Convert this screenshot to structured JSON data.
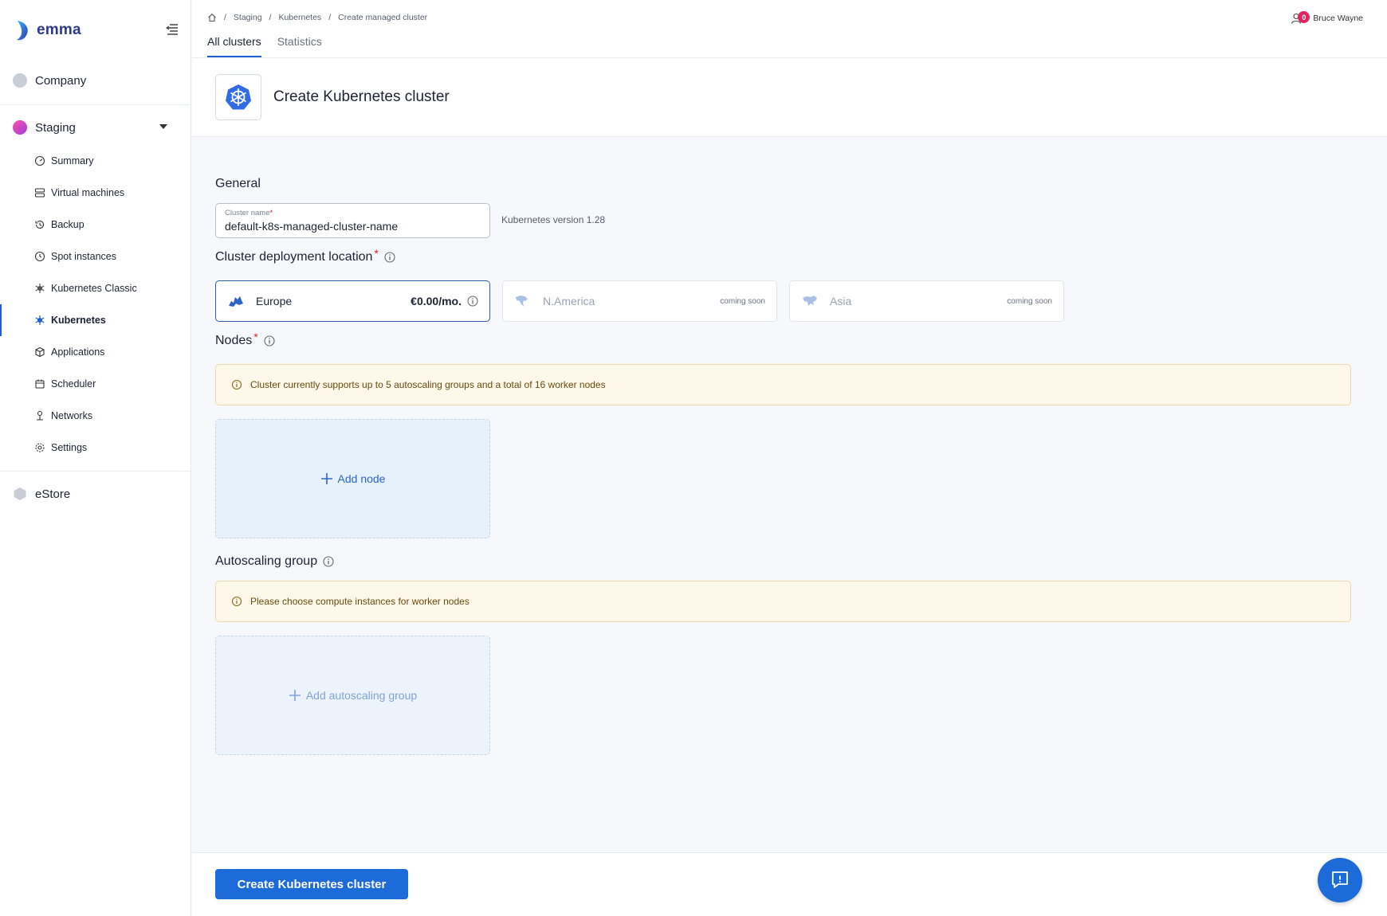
{
  "brand": {
    "name": "emma",
    "color": "#1d5fd6"
  },
  "sidebar": {
    "orgs": [
      {
        "label": "Company"
      },
      {
        "label": "Staging"
      },
      {
        "label": "eStore"
      }
    ],
    "items": [
      {
        "label": "Summary",
        "icon": "gauge-icon"
      },
      {
        "label": "Virtual machines",
        "icon": "server-icon"
      },
      {
        "label": "Backup",
        "icon": "history-icon"
      },
      {
        "label": "Spot instances",
        "icon": "clock-icon"
      },
      {
        "label": "Kubernetes Classic",
        "icon": "kubernetes-icon"
      },
      {
        "label": "Kubernetes",
        "icon": "kubernetes-icon",
        "active": true
      },
      {
        "label": "Applications",
        "icon": "cube-icon"
      },
      {
        "label": "Scheduler",
        "icon": "calendar-icon"
      },
      {
        "label": "Networks",
        "icon": "network-icon"
      },
      {
        "label": "Settings",
        "icon": "gear-icon"
      }
    ]
  },
  "header": {
    "breadcrumbs": [
      "Staging",
      "Kubernetes",
      "Create managed cluster"
    ],
    "tabs": [
      {
        "label": "All clusters",
        "active": true
      },
      {
        "label": "Statistics"
      }
    ],
    "user": {
      "name": "Bruce Wayne",
      "notifications": "0"
    }
  },
  "page": {
    "title": "Create Kubernetes cluster"
  },
  "general": {
    "title": "General",
    "cluster_name_label": "Cluster name",
    "cluster_name_value": "default-k8s-managed-cluster-name",
    "k8s_version": "Kubernetes version 1.28"
  },
  "location": {
    "title": "Cluster deployment location",
    "options": [
      {
        "name": "Europe",
        "price": "€0.00/mo.",
        "selected": true
      },
      {
        "name": "N.America",
        "status": "coming soon"
      },
      {
        "name": "Asia",
        "status": "coming soon"
      }
    ]
  },
  "nodes": {
    "title": "Nodes",
    "alert": "Cluster currently supports up to 5 autoscaling groups and a total of 16 worker nodes",
    "add_label": "Add node"
  },
  "autoscaling": {
    "title": "Autoscaling group",
    "alert": "Please choose compute instances for worker nodes",
    "add_label": "Add autoscaling group"
  },
  "footer": {
    "submit_label": "Create Kubernetes cluster"
  },
  "colors": {
    "primary": "#1d6ad9",
    "alert_bg": "#fef8ea",
    "alert_border": "#ecd9a9",
    "badge": "#e0245e"
  }
}
